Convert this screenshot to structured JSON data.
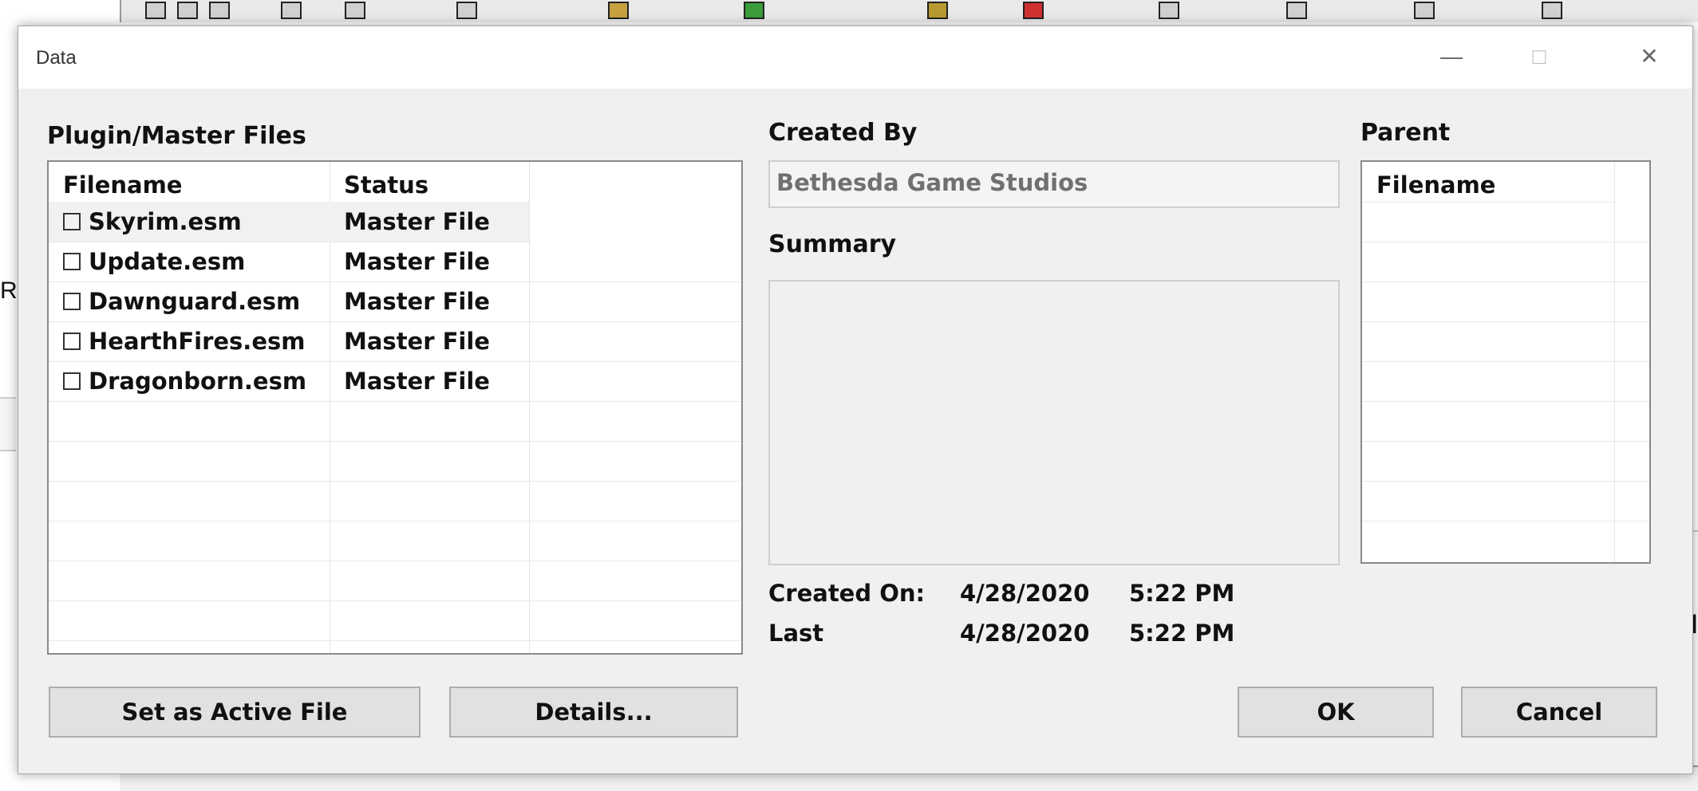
{
  "background": {
    "left_text": "Re",
    "right_text": "d"
  },
  "window": {
    "title": "Data",
    "controls": {
      "minimize": "—",
      "maximize": "□",
      "close": "✕"
    }
  },
  "plugin_files": {
    "label": "Plugin/Master Files",
    "columns": [
      "Filename",
      "Status"
    ],
    "rows": [
      {
        "filename": "Skyrim.esm",
        "status": "Master File"
      },
      {
        "filename": "Update.esm",
        "status": "Master File"
      },
      {
        "filename": "Dawnguard.esm",
        "status": "Master File"
      },
      {
        "filename": "HearthFires.esm",
        "status": "Master File"
      },
      {
        "filename": "Dragonborn.esm",
        "status": "Master File"
      }
    ]
  },
  "created_by": {
    "label": "Created By",
    "value": "Bethesda Game Studios"
  },
  "summary": {
    "label": "Summary",
    "value": ""
  },
  "dates": {
    "created_label": "Created On:",
    "created_date": "4/28/2020",
    "created_time": "5:22 PM",
    "modified_label": "Last",
    "modified_date": "4/28/2020",
    "modified_time": "5:22 PM"
  },
  "parent": {
    "label": "Parent",
    "columns": [
      "Filename"
    ]
  },
  "buttons": {
    "set_active": "Set as Active File",
    "details": "Details...",
    "ok": "OK",
    "cancel": "Cancel"
  }
}
